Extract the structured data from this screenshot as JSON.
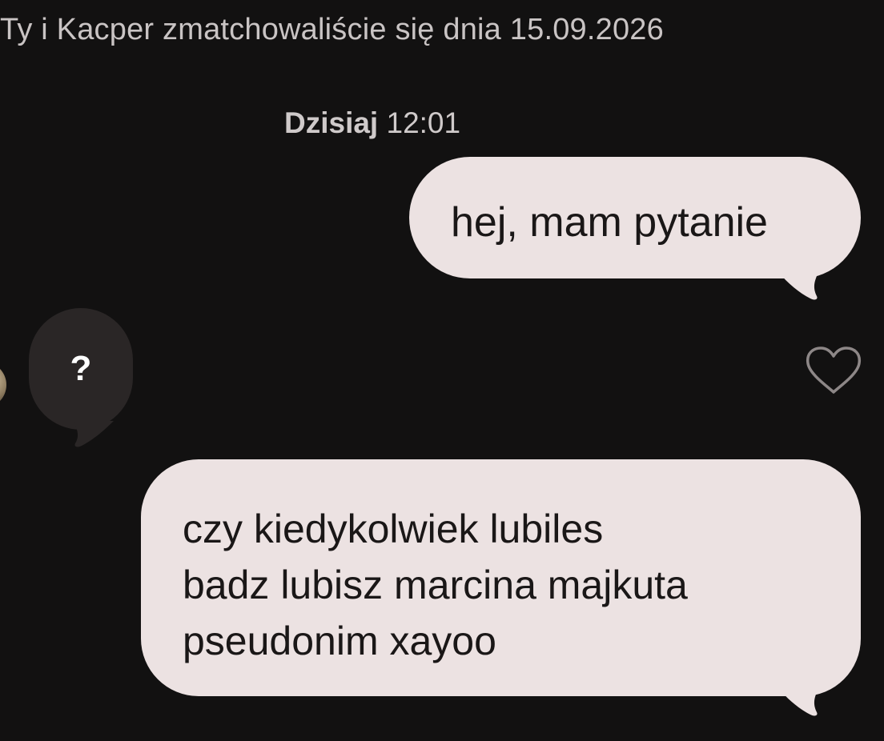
{
  "match_banner": "Ty i Kacper zmatchowaliście się dnia 15.09.2026",
  "timestamp": {
    "day": "Dzisiaj",
    "time": "12:01"
  },
  "messages": [
    {
      "direction": "outgoing",
      "lines": [
        "hej, mam pytanie"
      ]
    },
    {
      "direction": "incoming",
      "lines": [
        "?"
      ]
    },
    {
      "direction": "outgoing",
      "lines": [
        "czy kiedykolwiek lubiles",
        "badz lubisz marcina majkuta",
        "pseudonim xayoo"
      ]
    }
  ],
  "icons": {
    "like": "heart-outline-icon",
    "avatar": "contact-avatar"
  },
  "colors": {
    "background": "#121111",
    "outgoing_bubble": "#ece2e2",
    "incoming_bubble": "#2a2626",
    "outgoing_text": "#1a1717",
    "incoming_text": "#ffffff",
    "meta_text": "#c9c4c4"
  }
}
